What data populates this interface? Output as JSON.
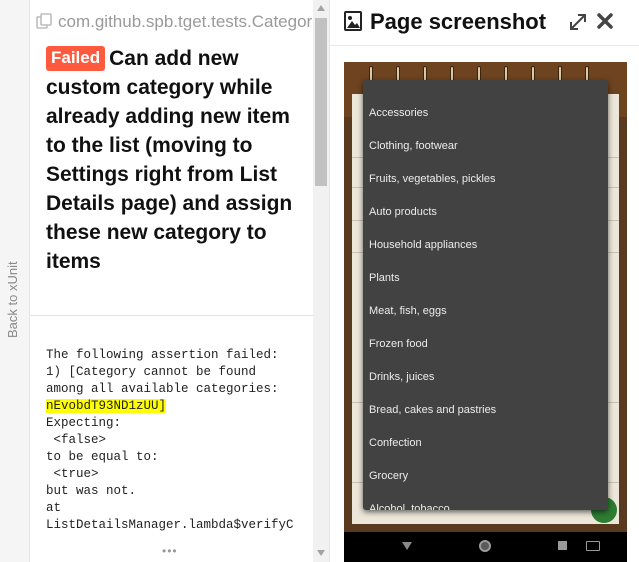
{
  "nav": {
    "back_label": "Back to xUnit"
  },
  "test": {
    "breadcrumb": "com.github.spb.tget.tests.CategoriesTests",
    "status": "Failed",
    "status_color": "#fd5a3e",
    "title": "Can add new custom category while already adding new item to the list (moving to Settings right from List Details page) and assign these new category to items",
    "message": {
      "line1": "The following assertion failed:",
      "line2": "1) [Category cannot be found",
      "line3": "among all available categories:",
      "highlight": "nEvobdT93ND1zUU]",
      "line5": "Expecting:",
      "line6": " <false>",
      "line7": "to be equal to:",
      "line8": " <true>",
      "line9": "but was not.",
      "line10": "at",
      "line11": "ListDetailsManager.lambda$verifyC"
    },
    "more": "•••"
  },
  "screenshot_pane": {
    "title": "Page screenshot",
    "icons": [
      "image-icon",
      "expand-icon",
      "close-icon"
    ],
    "dropdown_items": [
      "Accessories",
      "Clothing, footwear",
      "Fruits, vegetables, pickles",
      "Auto products",
      "Household appliances",
      "Plants",
      "Meat, fish, eggs",
      "Frozen food",
      "Drinks, juices",
      "Bread, cakes and pastries",
      "Confection",
      "Grocery",
      "Alcohol, tobacco"
    ]
  }
}
